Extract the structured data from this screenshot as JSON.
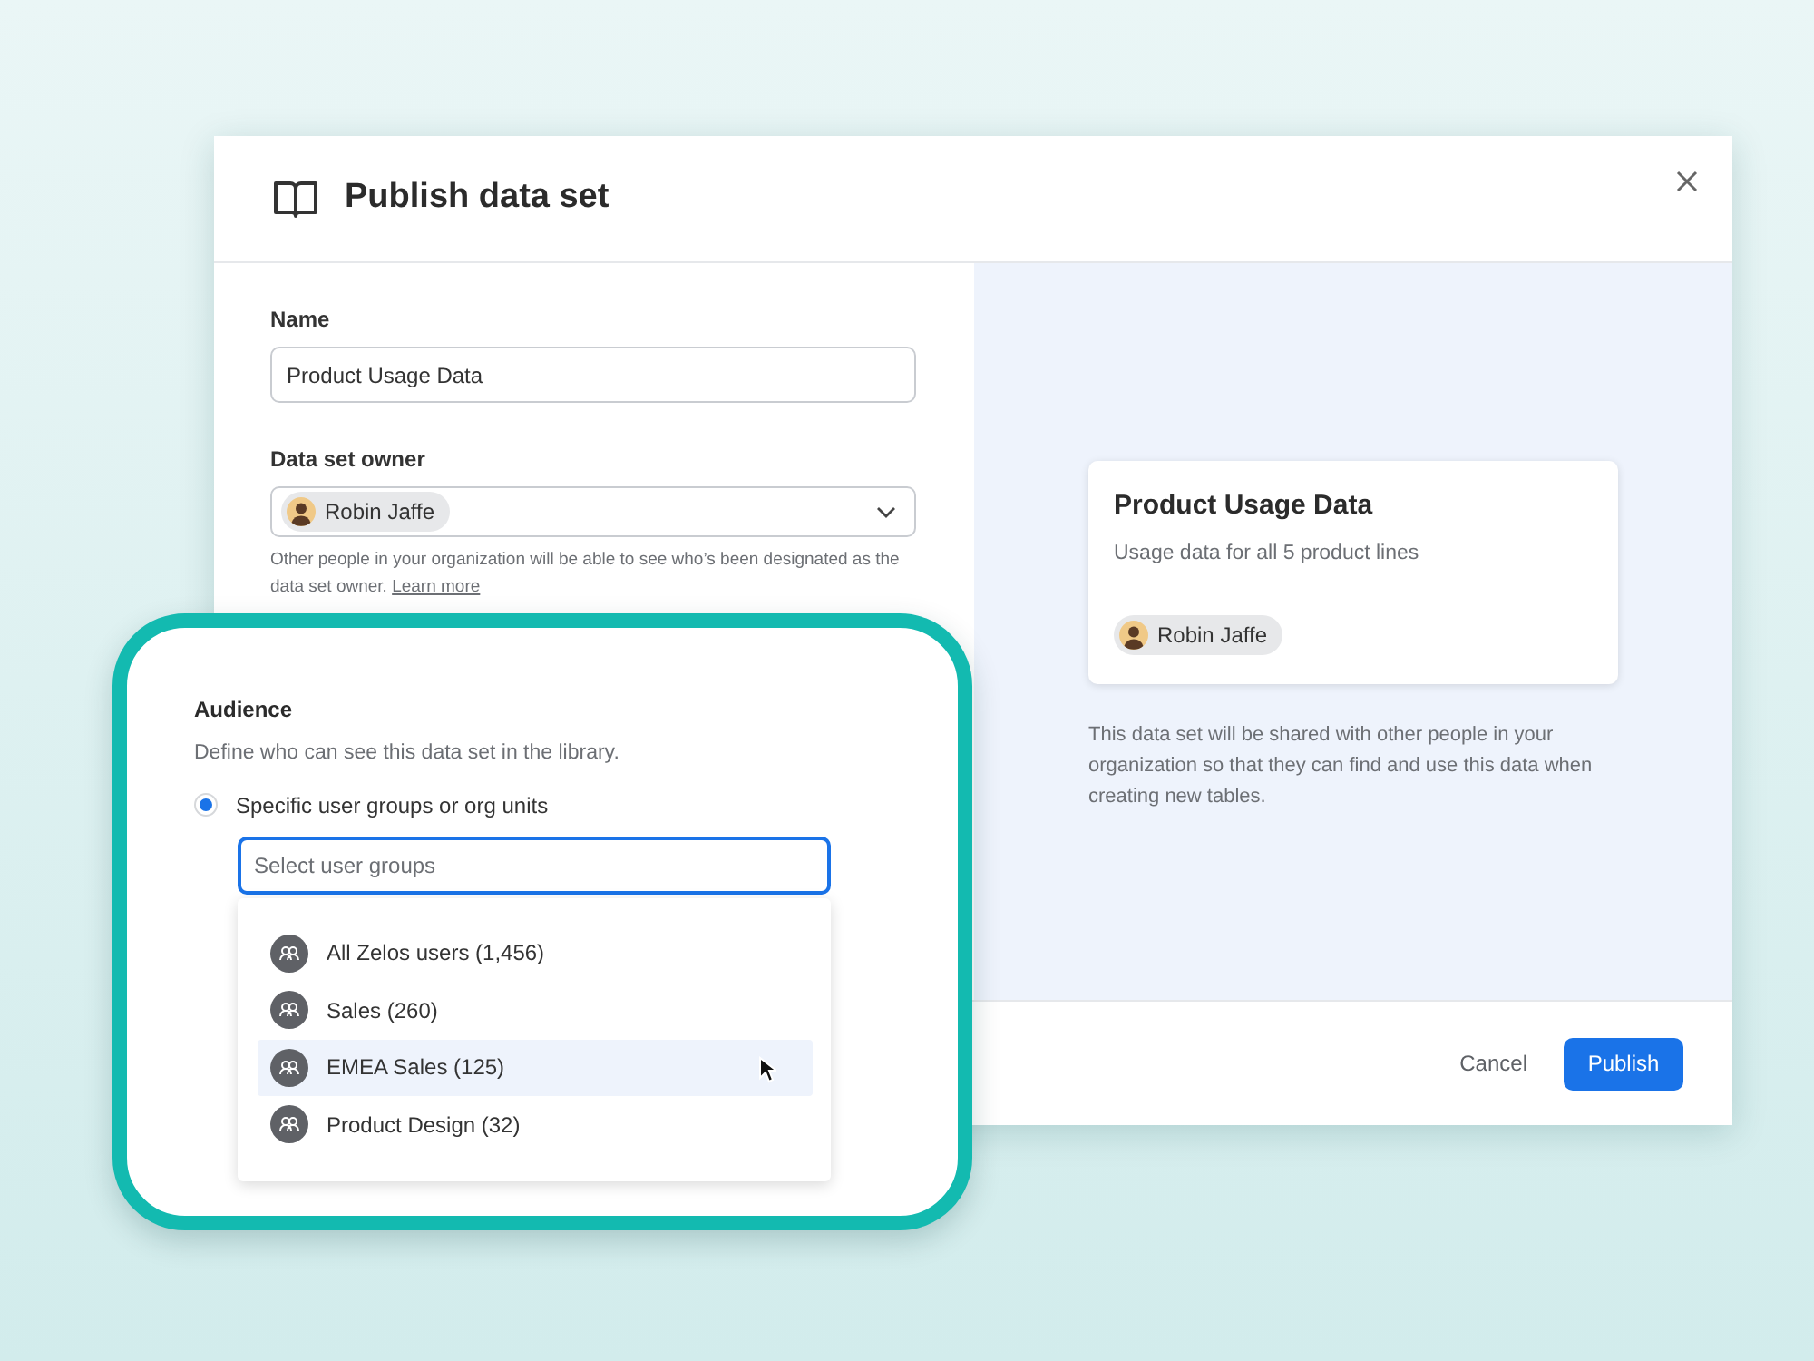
{
  "dialog": {
    "title": "Publish data set",
    "name_field": {
      "label": "Name",
      "value": "Product Usage Data"
    },
    "owner_field": {
      "label": "Data set owner",
      "value": "Robin Jaffe",
      "help": "Other people in your organization will be able to see who’s been designated as the data set owner.",
      "help_link": "Learn more"
    },
    "preview": {
      "title": "Product Usage Data",
      "description": "Usage data for all 5 product lines",
      "owner": "Robin Jaffe",
      "note": "This data set will be shared with other people in your organization so that they can find and use this data when creating new tables."
    },
    "buttons": [
      {
        "label": "Cancel",
        "kind": "secondary"
      },
      {
        "label": "Publish",
        "kind": "primary"
      }
    ]
  },
  "audience": {
    "title": "Audience",
    "description": "Define who can see this data set in the library.",
    "options": [
      {
        "label": "Specific user groups or org units",
        "selected": true
      }
    ],
    "search": {
      "placeholder": "Select user groups"
    },
    "groups": [
      {
        "label": "All Zelos users (1,456)",
        "selected": false
      },
      {
        "label": "Sales (260)",
        "selected": false
      },
      {
        "label": "EMEA Sales (125)",
        "selected": true
      },
      {
        "label": "Product Design (32)",
        "selected": false
      }
    ]
  }
}
